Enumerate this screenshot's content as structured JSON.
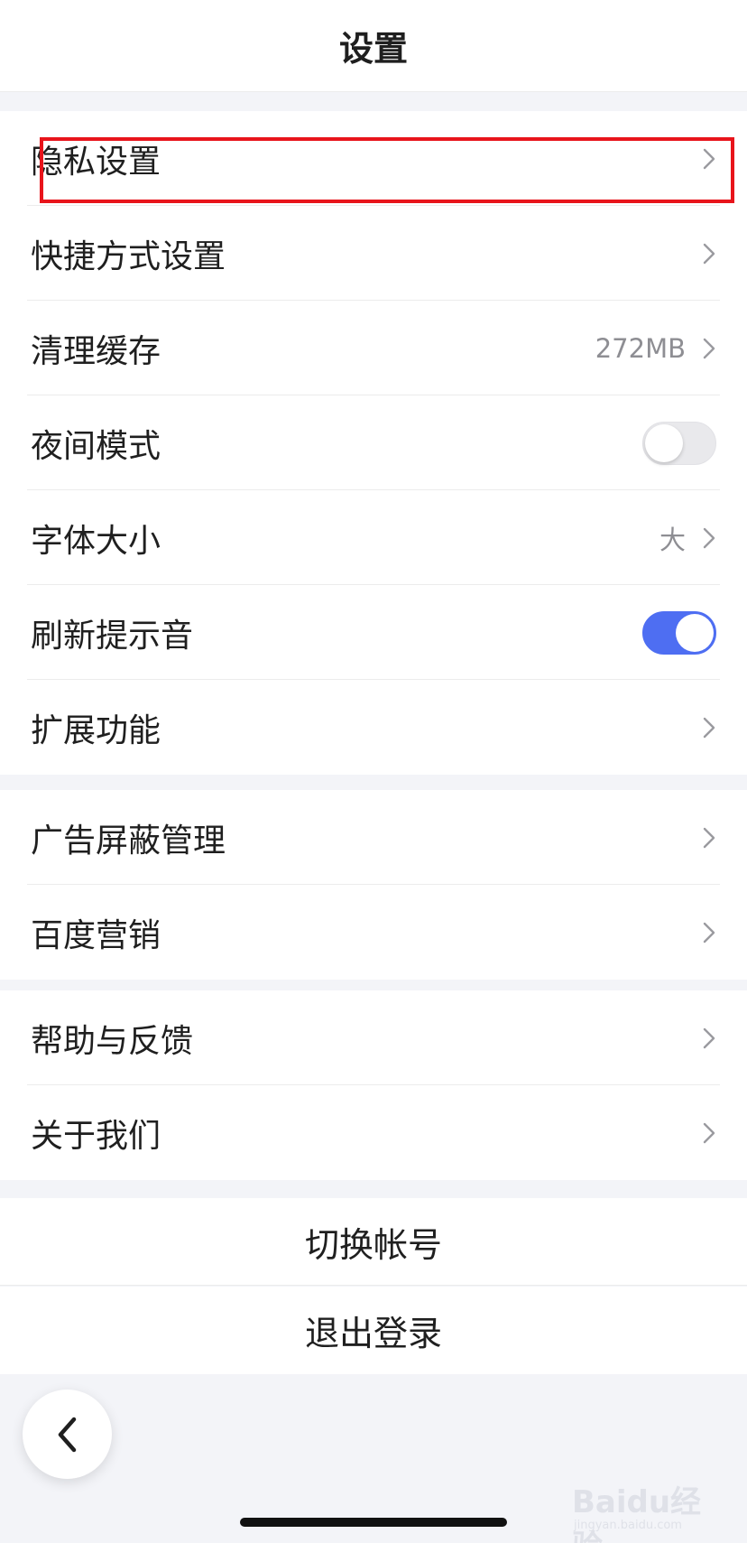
{
  "header": {
    "title": "设置"
  },
  "group1": [
    {
      "label": "隐私设置"
    },
    {
      "label": "快捷方式设置"
    },
    {
      "label": "清理缓存",
      "value": "272MB"
    },
    {
      "label": "夜间模式",
      "toggle": false
    },
    {
      "label": "字体大小",
      "value": "大"
    },
    {
      "label": "刷新提示音",
      "toggle": true
    },
    {
      "label": "扩展功能"
    }
  ],
  "group2": [
    {
      "label": "广告屏蔽管理"
    },
    {
      "label": "百度营销"
    }
  ],
  "group3": [
    {
      "label": "帮助与反馈"
    },
    {
      "label": "关于我们"
    }
  ],
  "actions": {
    "switch_account": "切换帐号",
    "logout": "退出登录"
  },
  "watermark": {
    "brand": "Baidu经验",
    "url": "jingyan.baidu.com"
  },
  "colors": {
    "toggle_on": "#4e6ef2",
    "highlight_box": "#e8141b",
    "page_bg": "#f3f4f8"
  },
  "icons": {
    "row_chevron": "chevron-right-icon",
    "back": "chevron-left-icon"
  }
}
